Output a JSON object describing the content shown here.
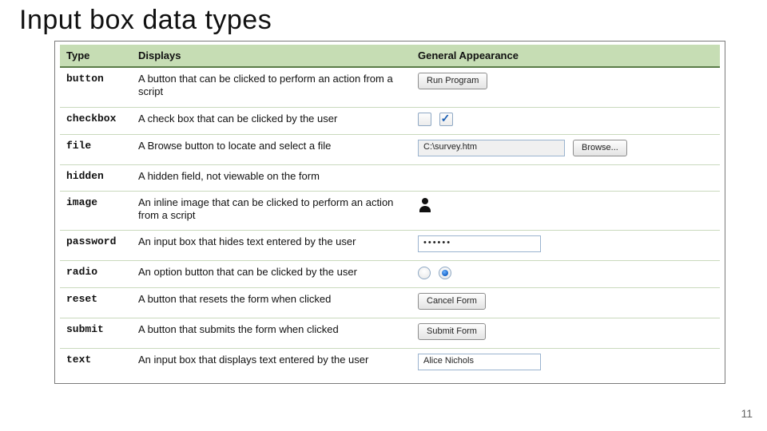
{
  "page_title": "Input box data types",
  "page_number": "11",
  "headers": {
    "type": "Type",
    "displays": "Displays",
    "appearance": "General Appearance"
  },
  "rows": [
    {
      "type": "button",
      "displays": "A button that can be clicked to perform an action from a script",
      "appearance_kind": "button",
      "button_label": "Run Program"
    },
    {
      "type": "checkbox",
      "displays": "A check box that can be clicked by the user",
      "appearance_kind": "checkbox"
    },
    {
      "type": "file",
      "displays": "A Browse button to locate and select a file",
      "appearance_kind": "file",
      "file_path": "C:\\survey.htm",
      "browse_label": "Browse..."
    },
    {
      "type": "hidden",
      "displays": "A hidden field, not viewable on the form",
      "appearance_kind": "none"
    },
    {
      "type": "image",
      "displays": "An inline image that can be clicked to perform an action from a script",
      "appearance_kind": "image"
    },
    {
      "type": "password",
      "displays": "An input box that hides text entered by the user",
      "appearance_kind": "password",
      "password_mask": "••••••"
    },
    {
      "type": "radio",
      "displays": "An option button that can be clicked by the user",
      "appearance_kind": "radio"
    },
    {
      "type": "reset",
      "displays": "A button that resets the form when clicked",
      "appearance_kind": "button",
      "button_label": "Cancel Form"
    },
    {
      "type": "submit",
      "displays": "A button that submits the form when clicked",
      "appearance_kind": "button",
      "button_label": "Submit Form"
    },
    {
      "type": "text",
      "displays": "An input box that displays text entered by the user",
      "appearance_kind": "text",
      "text_value": "Alice Nichols"
    }
  ]
}
